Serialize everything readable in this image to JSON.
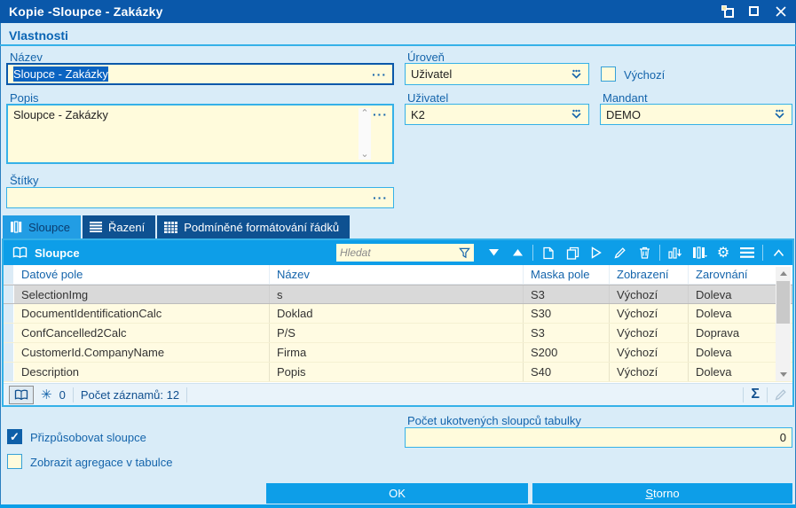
{
  "window": {
    "title": "Kopie -Sloupce - Zakázky"
  },
  "icons": {
    "sigma": "Σ",
    "asterisk": "✳",
    "gear": "⚙",
    "ellipsis": "···",
    "check": "✓",
    "chevron_up_small": "⌃",
    "chevron_down_small": "⌄"
  },
  "properties": {
    "header": "Vlastnosti",
    "nazev": {
      "label": "Název",
      "value": "Sloupce - Zakázky"
    },
    "uroven": {
      "label": "Úroveň",
      "value": "Uživatel"
    },
    "vychozi": {
      "label": "Výchozí",
      "checked": false
    },
    "popis": {
      "label": "Popis",
      "value": "Sloupce - Zakázky"
    },
    "uzivatel": {
      "label": "Uživatel",
      "value": "K2"
    },
    "mandant": {
      "label": "Mandant",
      "value": "DEMO"
    },
    "stitky": {
      "label": "Štítky",
      "value": ""
    }
  },
  "tabs": [
    {
      "label": "Sloupce",
      "active": true
    },
    {
      "label": "Řazení",
      "active": false
    },
    {
      "label": "Podmíněné formátování řádků",
      "active": false
    }
  ],
  "panel": {
    "title": "Sloupce",
    "search_placeholder": "Hledat",
    "table": {
      "columns": [
        "Datové pole",
        "Název",
        "Maska pole",
        "Zobrazení",
        "Zarovnání"
      ],
      "rows": [
        [
          "SelectionImg",
          "s",
          "S3",
          "Výchozí",
          "Doleva"
        ],
        [
          "DocumentIdentificationCalc",
          "Doklad",
          "S30",
          "Výchozí",
          "Doleva"
        ],
        [
          "ConfCancelled2Calc",
          "P/S",
          "S3",
          "Výchozí",
          "Doprava"
        ],
        [
          "CustomerId.CompanyName",
          "Firma",
          "S200",
          "Výchozí",
          "Doleva"
        ],
        [
          "Description",
          "Popis",
          "S40",
          "Výchozí",
          "Doleva"
        ]
      ],
      "selected_row_index": 0
    },
    "status": {
      "asterisk_count": "0",
      "record_count": "Počet záznamů: 12"
    }
  },
  "footer": {
    "fit_columns": {
      "label": "Přizpůsobovat sloupce",
      "checked": true
    },
    "show_aggregations": {
      "label": "Zobrazit agregace v tabulce",
      "checked": false
    },
    "anchored_columns": {
      "label": "Počet ukotvených sloupců tabulky",
      "value": "0"
    },
    "ok_label": "OK",
    "storno_accel": "S",
    "storno_rest": "torno"
  }
}
